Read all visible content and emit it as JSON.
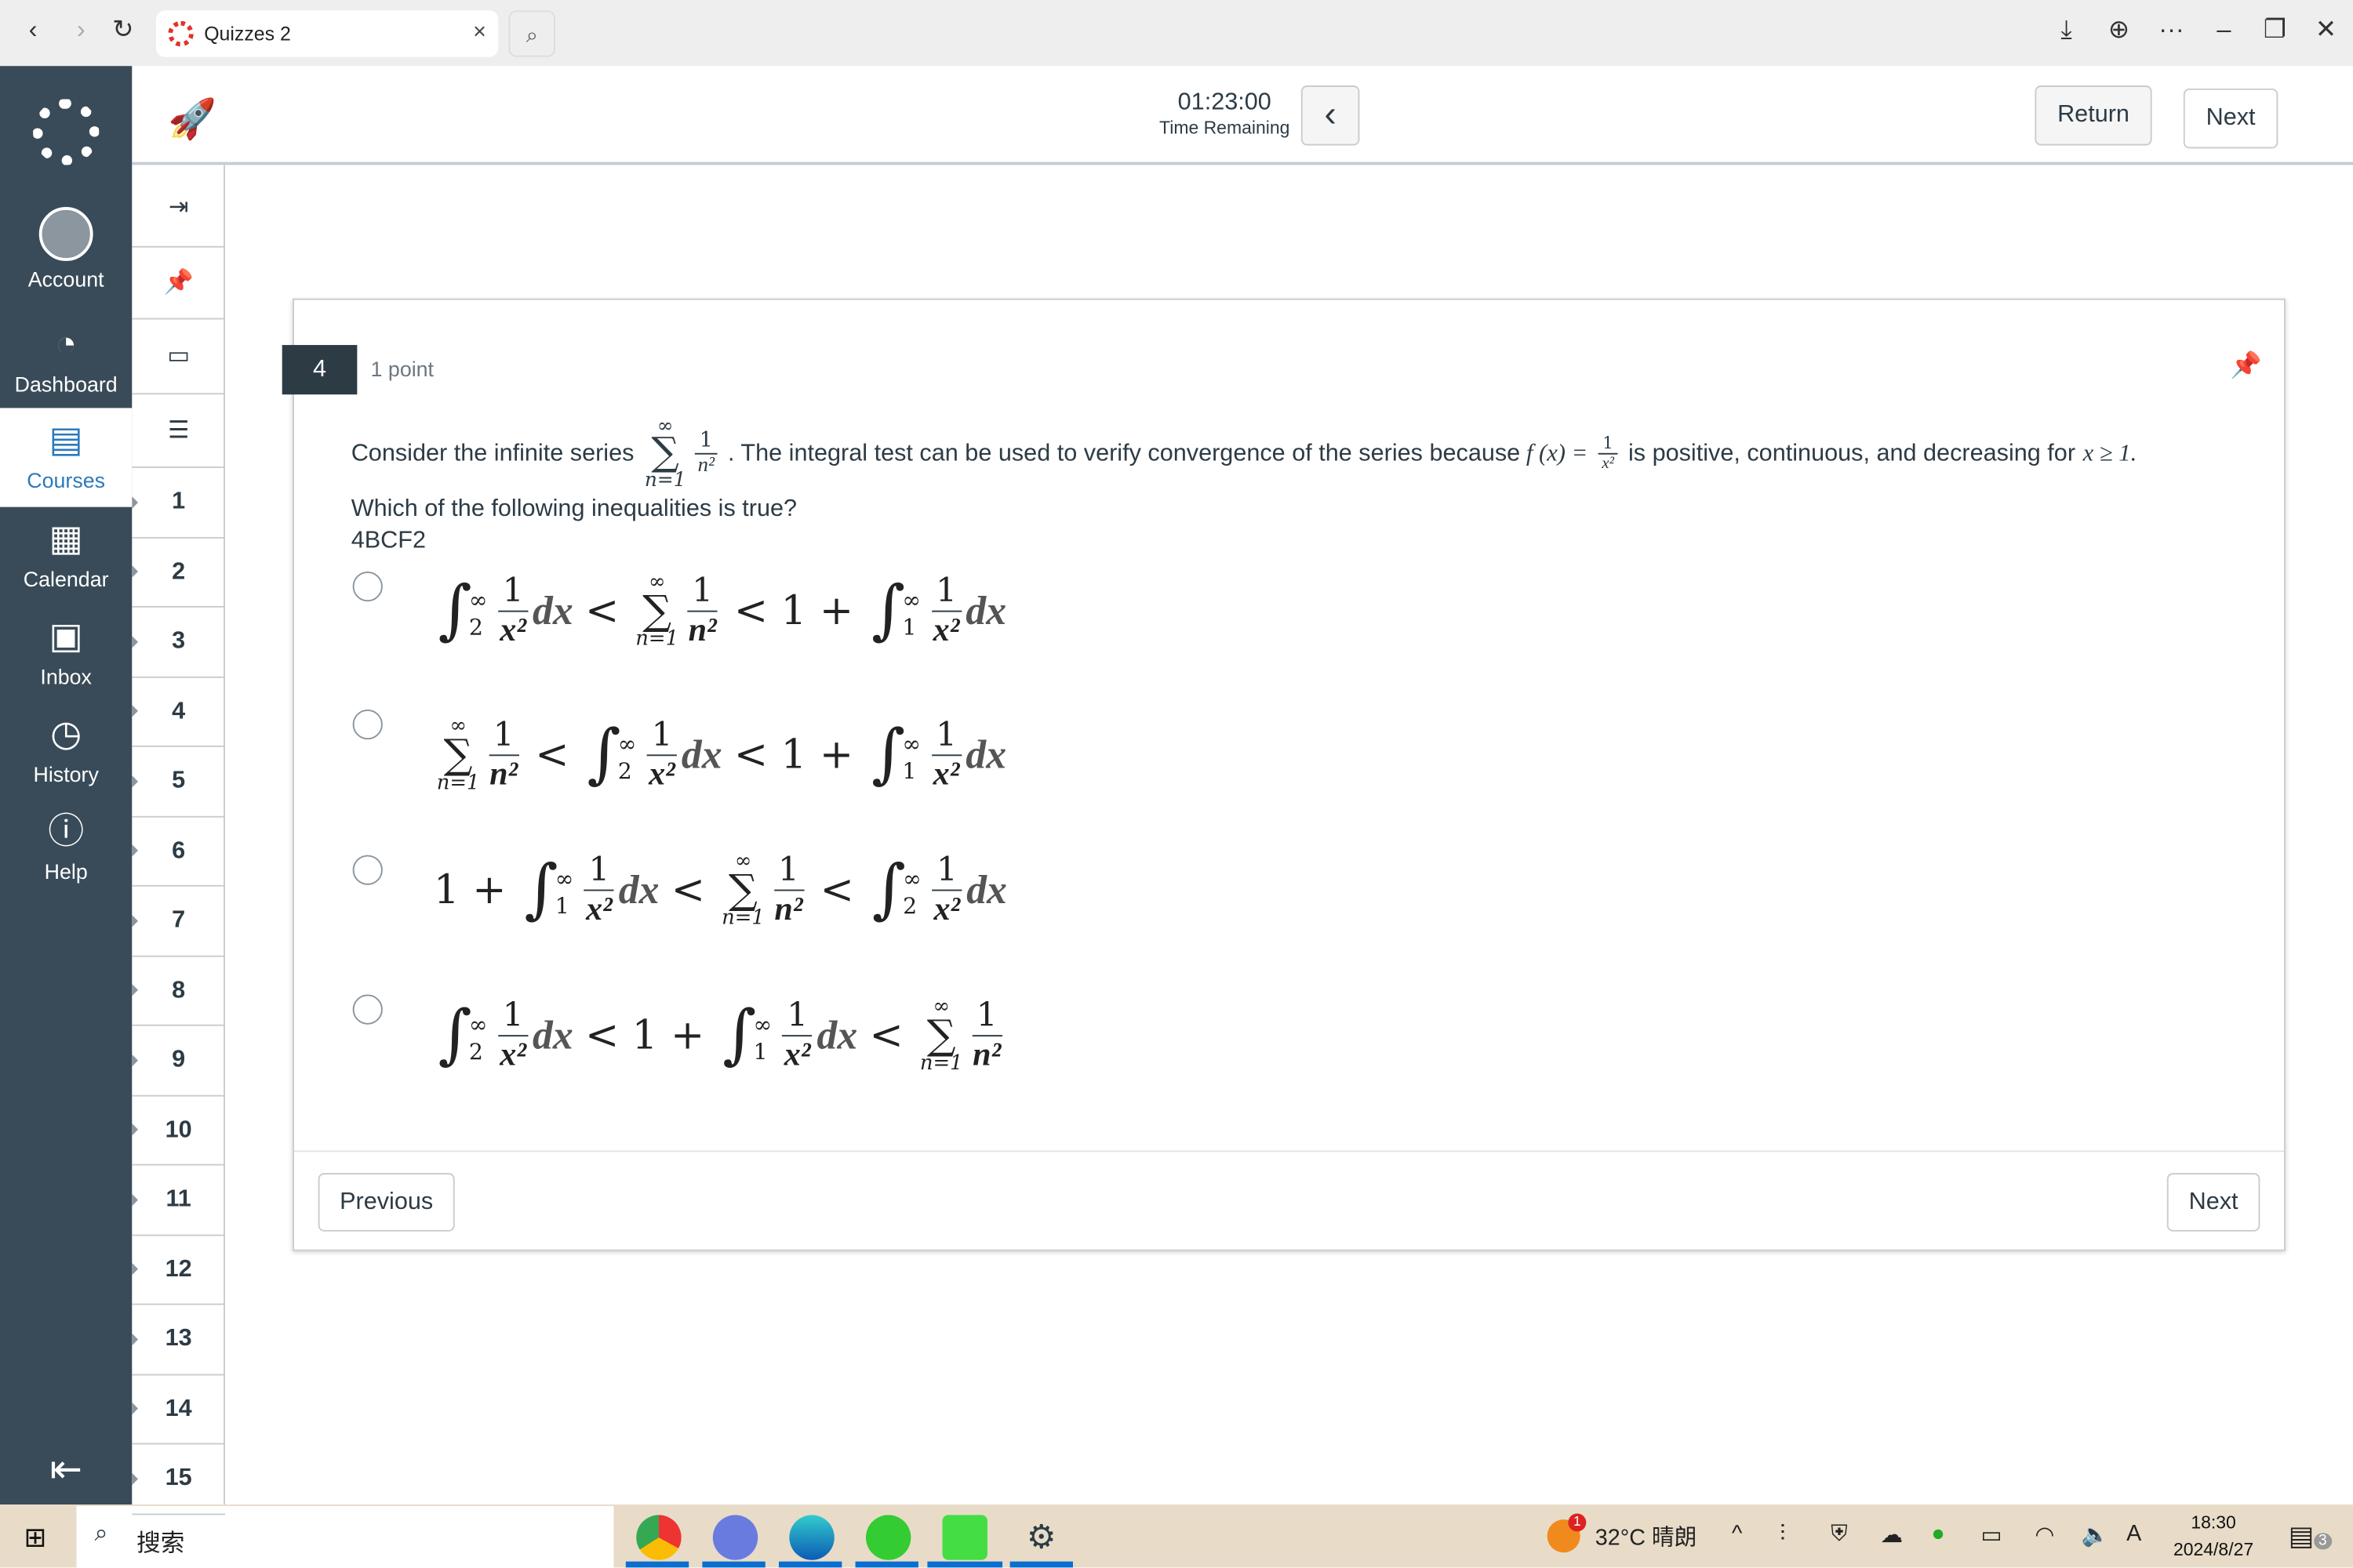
{
  "browser": {
    "tab_title": "Quizzes 2",
    "back": "‹",
    "forward": "›",
    "reload": "↻",
    "close_tab": "×",
    "search_icon": "⌕",
    "download": "⤓",
    "globe": "⊕",
    "more": "···",
    "minimize": "–",
    "restore": "❐",
    "close": "✕"
  },
  "nav": {
    "items": [
      {
        "label": "Account",
        "icon": "account-icon"
      },
      {
        "label": "Dashboard",
        "icon": "dashboard-icon"
      },
      {
        "label": "Courses",
        "icon": "courses-icon",
        "active": true
      },
      {
        "label": "Calendar",
        "icon": "calendar-icon"
      },
      {
        "label": "Inbox",
        "icon": "inbox-icon"
      },
      {
        "label": "History",
        "icon": "history-icon"
      },
      {
        "label": "Help",
        "icon": "help-icon"
      }
    ],
    "collapse": "⇤"
  },
  "header": {
    "timer": "01:23:00",
    "timer_label": "Time Remaining",
    "return_label": "Return",
    "next_label": "Next",
    "toggle": "‹"
  },
  "question_nav": {
    "tools": [
      "⇥",
      "📌",
      "▭",
      "☰"
    ],
    "numbers": [
      "1",
      "2",
      "3",
      "4",
      "5",
      "6",
      "7",
      "8",
      "9",
      "10",
      "11",
      "12",
      "13",
      "14",
      "15"
    ]
  },
  "question": {
    "number": "4",
    "points": "1 point",
    "text_a": "Consider the infinite series",
    "text_b": ". The integral test can be used to verify convergence of the series because",
    "text_c": "is positive, continuous, and decreasing for",
    "fx": "f (x) =",
    "cond": "x ≥ 1.",
    "prompt": "Which of the following inequalities is true?",
    "code": "4BCF2"
  },
  "options": [
    [
      {
        "t": "int",
        "lo": "2",
        "hi": "∞"
      },
      {
        "t": "frac",
        "n": "1",
        "d": "x²"
      },
      {
        "t": "v",
        "v": "dx"
      },
      {
        "t": "o",
        "v": "<"
      },
      {
        "t": "sum",
        "lo": "n=1",
        "hi": "∞"
      },
      {
        "t": "frac",
        "n": "1",
        "d": "n²"
      },
      {
        "t": "o",
        "v": "< 1 +"
      },
      {
        "t": "int",
        "lo": "1",
        "hi": "∞"
      },
      {
        "t": "frac",
        "n": "1",
        "d": "x²"
      },
      {
        "t": "v",
        "v": "dx"
      }
    ],
    [
      {
        "t": "sum",
        "lo": "n=1",
        "hi": "∞"
      },
      {
        "t": "frac",
        "n": "1",
        "d": "n²"
      },
      {
        "t": "o",
        "v": "<"
      },
      {
        "t": "int",
        "lo": "2",
        "hi": "∞"
      },
      {
        "t": "frac",
        "n": "1",
        "d": "x²"
      },
      {
        "t": "v",
        "v": "dx"
      },
      {
        "t": "o",
        "v": "< 1 +"
      },
      {
        "t": "int",
        "lo": "1",
        "hi": "∞"
      },
      {
        "t": "frac",
        "n": "1",
        "d": "x²"
      },
      {
        "t": "v",
        "v": "dx"
      }
    ],
    [
      {
        "t": "o",
        "v": "1 +"
      },
      {
        "t": "int",
        "lo": "1",
        "hi": "∞"
      },
      {
        "t": "frac",
        "n": "1",
        "d": "x²"
      },
      {
        "t": "v",
        "v": "dx"
      },
      {
        "t": "o",
        "v": "<"
      },
      {
        "t": "sum",
        "lo": "n=1",
        "hi": "∞"
      },
      {
        "t": "frac",
        "n": "1",
        "d": "n²"
      },
      {
        "t": "o",
        "v": "<"
      },
      {
        "t": "int",
        "lo": "2",
        "hi": "∞"
      },
      {
        "t": "frac",
        "n": "1",
        "d": "x²"
      },
      {
        "t": "v",
        "v": "dx"
      }
    ],
    [
      {
        "t": "int",
        "lo": "2",
        "hi": "∞"
      },
      {
        "t": "frac",
        "n": "1",
        "d": "x²"
      },
      {
        "t": "v",
        "v": "dx"
      },
      {
        "t": "o",
        "v": "< 1 +"
      },
      {
        "t": "int",
        "lo": "1",
        "hi": "∞"
      },
      {
        "t": "frac",
        "n": "1",
        "d": "x²"
      },
      {
        "t": "v",
        "v": "dx"
      },
      {
        "t": "o",
        "v": "<"
      },
      {
        "t": "sum",
        "lo": "n=1",
        "hi": "∞"
      },
      {
        "t": "frac",
        "n": "1",
        "d": "n²"
      }
    ]
  ],
  "footer": {
    "previous_label": "Previous",
    "next_label": "Next"
  },
  "taskbar": {
    "search_placeholder": "搜索",
    "weather": "32°C 晴朗",
    "time": "18:30",
    "date": "2024/8/27",
    "notif_count": "3",
    "weather_badge": "1"
  },
  "colors": {
    "nav_bg": "#394b58",
    "active_link": "#2b7abc",
    "taskbar_bg": "#e8dcc8"
  }
}
